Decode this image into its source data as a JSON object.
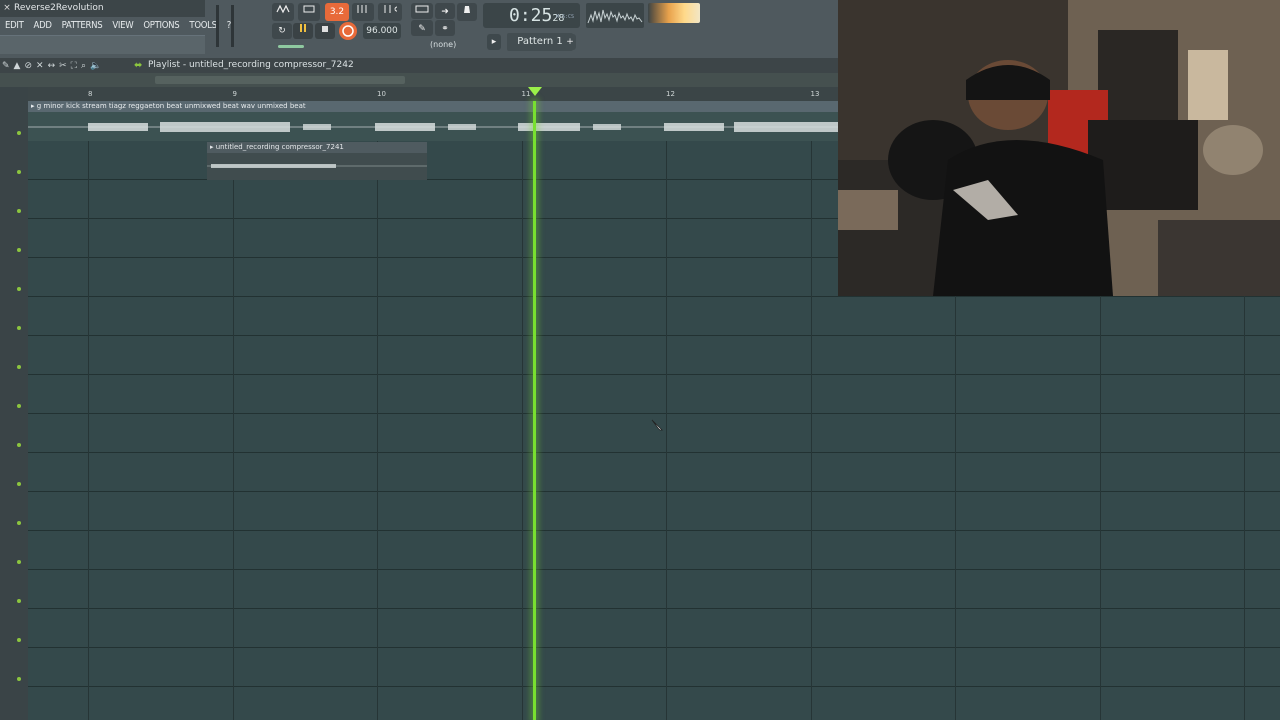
{
  "app": {
    "title": "Reverse2Revolution",
    "close_glyph": "×"
  },
  "menu": {
    "items": [
      "EDIT",
      "ADD",
      "PATTERNS",
      "VIEW",
      "OPTIONS",
      "TOOLS",
      "?"
    ]
  },
  "transport": {
    "time_display": "0:25",
    "time_frac": "28",
    "time_unit_label": "M:S:CS",
    "tempo": "96.000",
    "step_label": "3.2",
    "pattern": "Pattern 1",
    "snap": "(none)"
  },
  "playlist": {
    "title": "Playlist - untitled_recording compressor_7242",
    "ruler_ticks": [
      {
        "label": "8",
        "pos": 0
      },
      {
        "label": "9",
        "pos": 1
      },
      {
        "label": "10",
        "pos": 2
      },
      {
        "label": "11",
        "pos": 3
      },
      {
        "label": "12",
        "pos": 4
      },
      {
        "label": "13",
        "pos": 5
      }
    ],
    "clips": {
      "main": "g minor kick stream tiagz reggaeton beat unmixwed beat wav unmixed beat",
      "recording": "untitled_recording compressor_7241"
    }
  },
  "colors": {
    "playhead": "#78e030",
    "grid_bg": "#34494b",
    "accent_record": "#e86a3a"
  }
}
